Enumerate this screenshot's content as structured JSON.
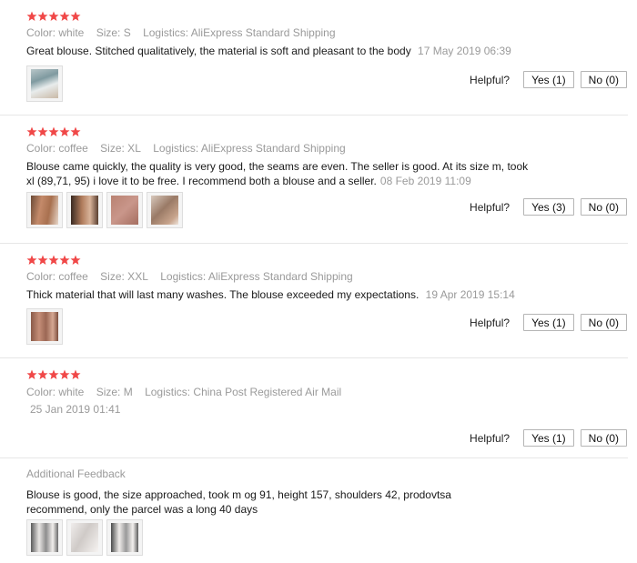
{
  "helpful_label": "Helpful?",
  "reviews": [
    {
      "stars": 5,
      "color": "Color: white",
      "size": "Size: S",
      "logistics": "Logistics: AliExpress Standard Shipping",
      "text": "Great blouse. Stitched qualitatively, the material is soft and pleasant to the body",
      "date": "17 May 2019 06:39",
      "yes": "Yes (1)",
      "no": "No (0)",
      "photos": [
        "photo-1"
      ]
    },
    {
      "stars": 5,
      "color": "Color: coffee",
      "size": "Size: XL",
      "logistics": "Logistics: AliExpress Standard Shipping",
      "text_line1": "Blouse came quickly, the quality is very good, the seams are even. The seller is good. At its size m, took",
      "text_line2": "xl (89,71, 95) i love it to be free. I recommend both a blouse and a seller.",
      "date": "08 Feb 2019 11:09",
      "yes": "Yes (3)",
      "no": "No (0)",
      "photos": [
        "photo-1",
        "photo-2",
        "photo-3",
        "photo-4"
      ]
    },
    {
      "stars": 5,
      "color": "Color: coffee",
      "size": "Size: XXL",
      "logistics": "Logistics: AliExpress Standard Shipping",
      "text": "Thick material that will last many washes. The blouse exceeded my expectations.",
      "date": "19 Apr 2019 15:14",
      "yes": "Yes (1)",
      "no": "No (0)",
      "photos": [
        "photo-1"
      ]
    },
    {
      "stars": 5,
      "color": "Color: white",
      "size": "Size: M",
      "logistics": "Logistics: China Post Registered Air Mail",
      "date": "25 Jan 2019 01:41",
      "yes": "Yes (1)",
      "no": "No (0)",
      "additional_label": "Additional Feedback",
      "additional_line1": "Blouse is good, the size approached, took m og 91, height 157, shoulders 42, prodovtsa",
      "additional_line2": "recommend, only the parcel was a long 40 days",
      "photos": [
        "photo-1",
        "photo-2",
        "photo-3"
      ]
    }
  ],
  "colors": {
    "star": "#f04848",
    "meta": "#9a9a9a",
    "divider": "#e6e6e6"
  }
}
